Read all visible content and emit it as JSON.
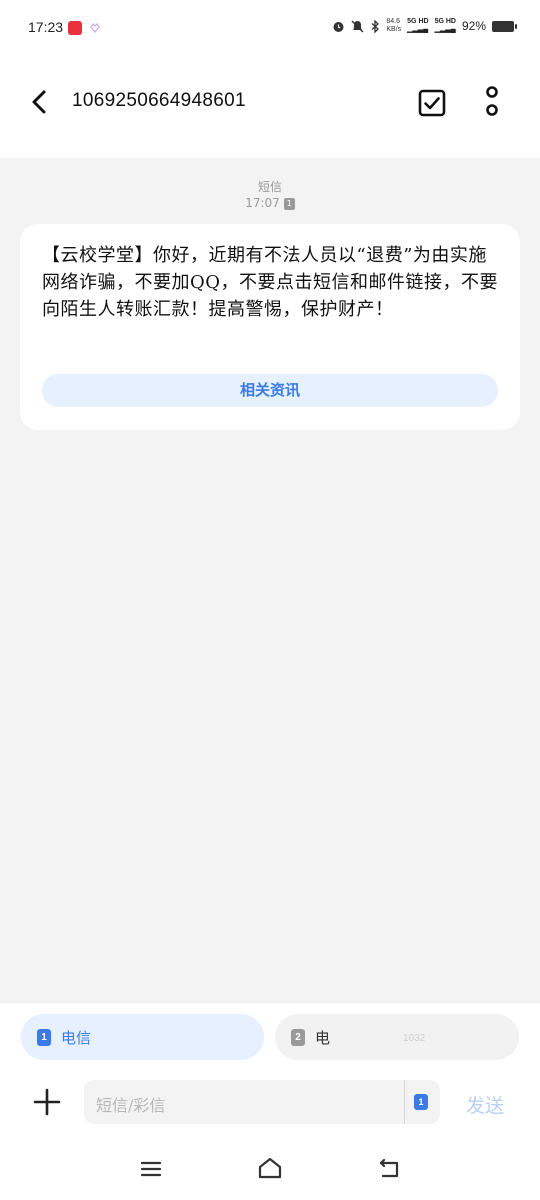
{
  "status_bar": {
    "time": "17:23",
    "network_speed": "84.6\nKB/s",
    "network_speed_value": "84.6",
    "network_speed_unit": "KB/s",
    "sim1_network": "5G HD",
    "sim2_network": "5G HD",
    "battery": "92%"
  },
  "header": {
    "title": "1069250664948601"
  },
  "conversation": {
    "message_type": "短信",
    "message_time": "17:07",
    "message_sim": "1",
    "message_text": "【云校学堂】你好，近期有不法人员以“退费”为由实施网络诈骗，不要加QQ，不要点击短信和邮件链接，不要向陌生人转账汇款！提高警惕，保护财产！",
    "related_button_label": "相关资讯"
  },
  "sim_selector": {
    "sim1": {
      "badge": "1",
      "label": "电信"
    },
    "sim2": {
      "badge": "2",
      "label": "电",
      "extra": "1032"
    }
  },
  "composer": {
    "placeholder": "短信/彩信",
    "sim_badge": "1",
    "send_label": "发送"
  },
  "colors": {
    "accent": "#3a7be8",
    "accent_light": "#e6f0ff",
    "send_disabled": "#b9d0f5",
    "background": "#f3f3f3"
  },
  "icons": {
    "back": "back-arrow-icon",
    "select": "checkbox-icon",
    "more": "more-vertical-icon",
    "add": "plus-icon",
    "nav_menu": "menu-icon",
    "nav_home": "home-icon",
    "nav_back": "back-icon"
  }
}
